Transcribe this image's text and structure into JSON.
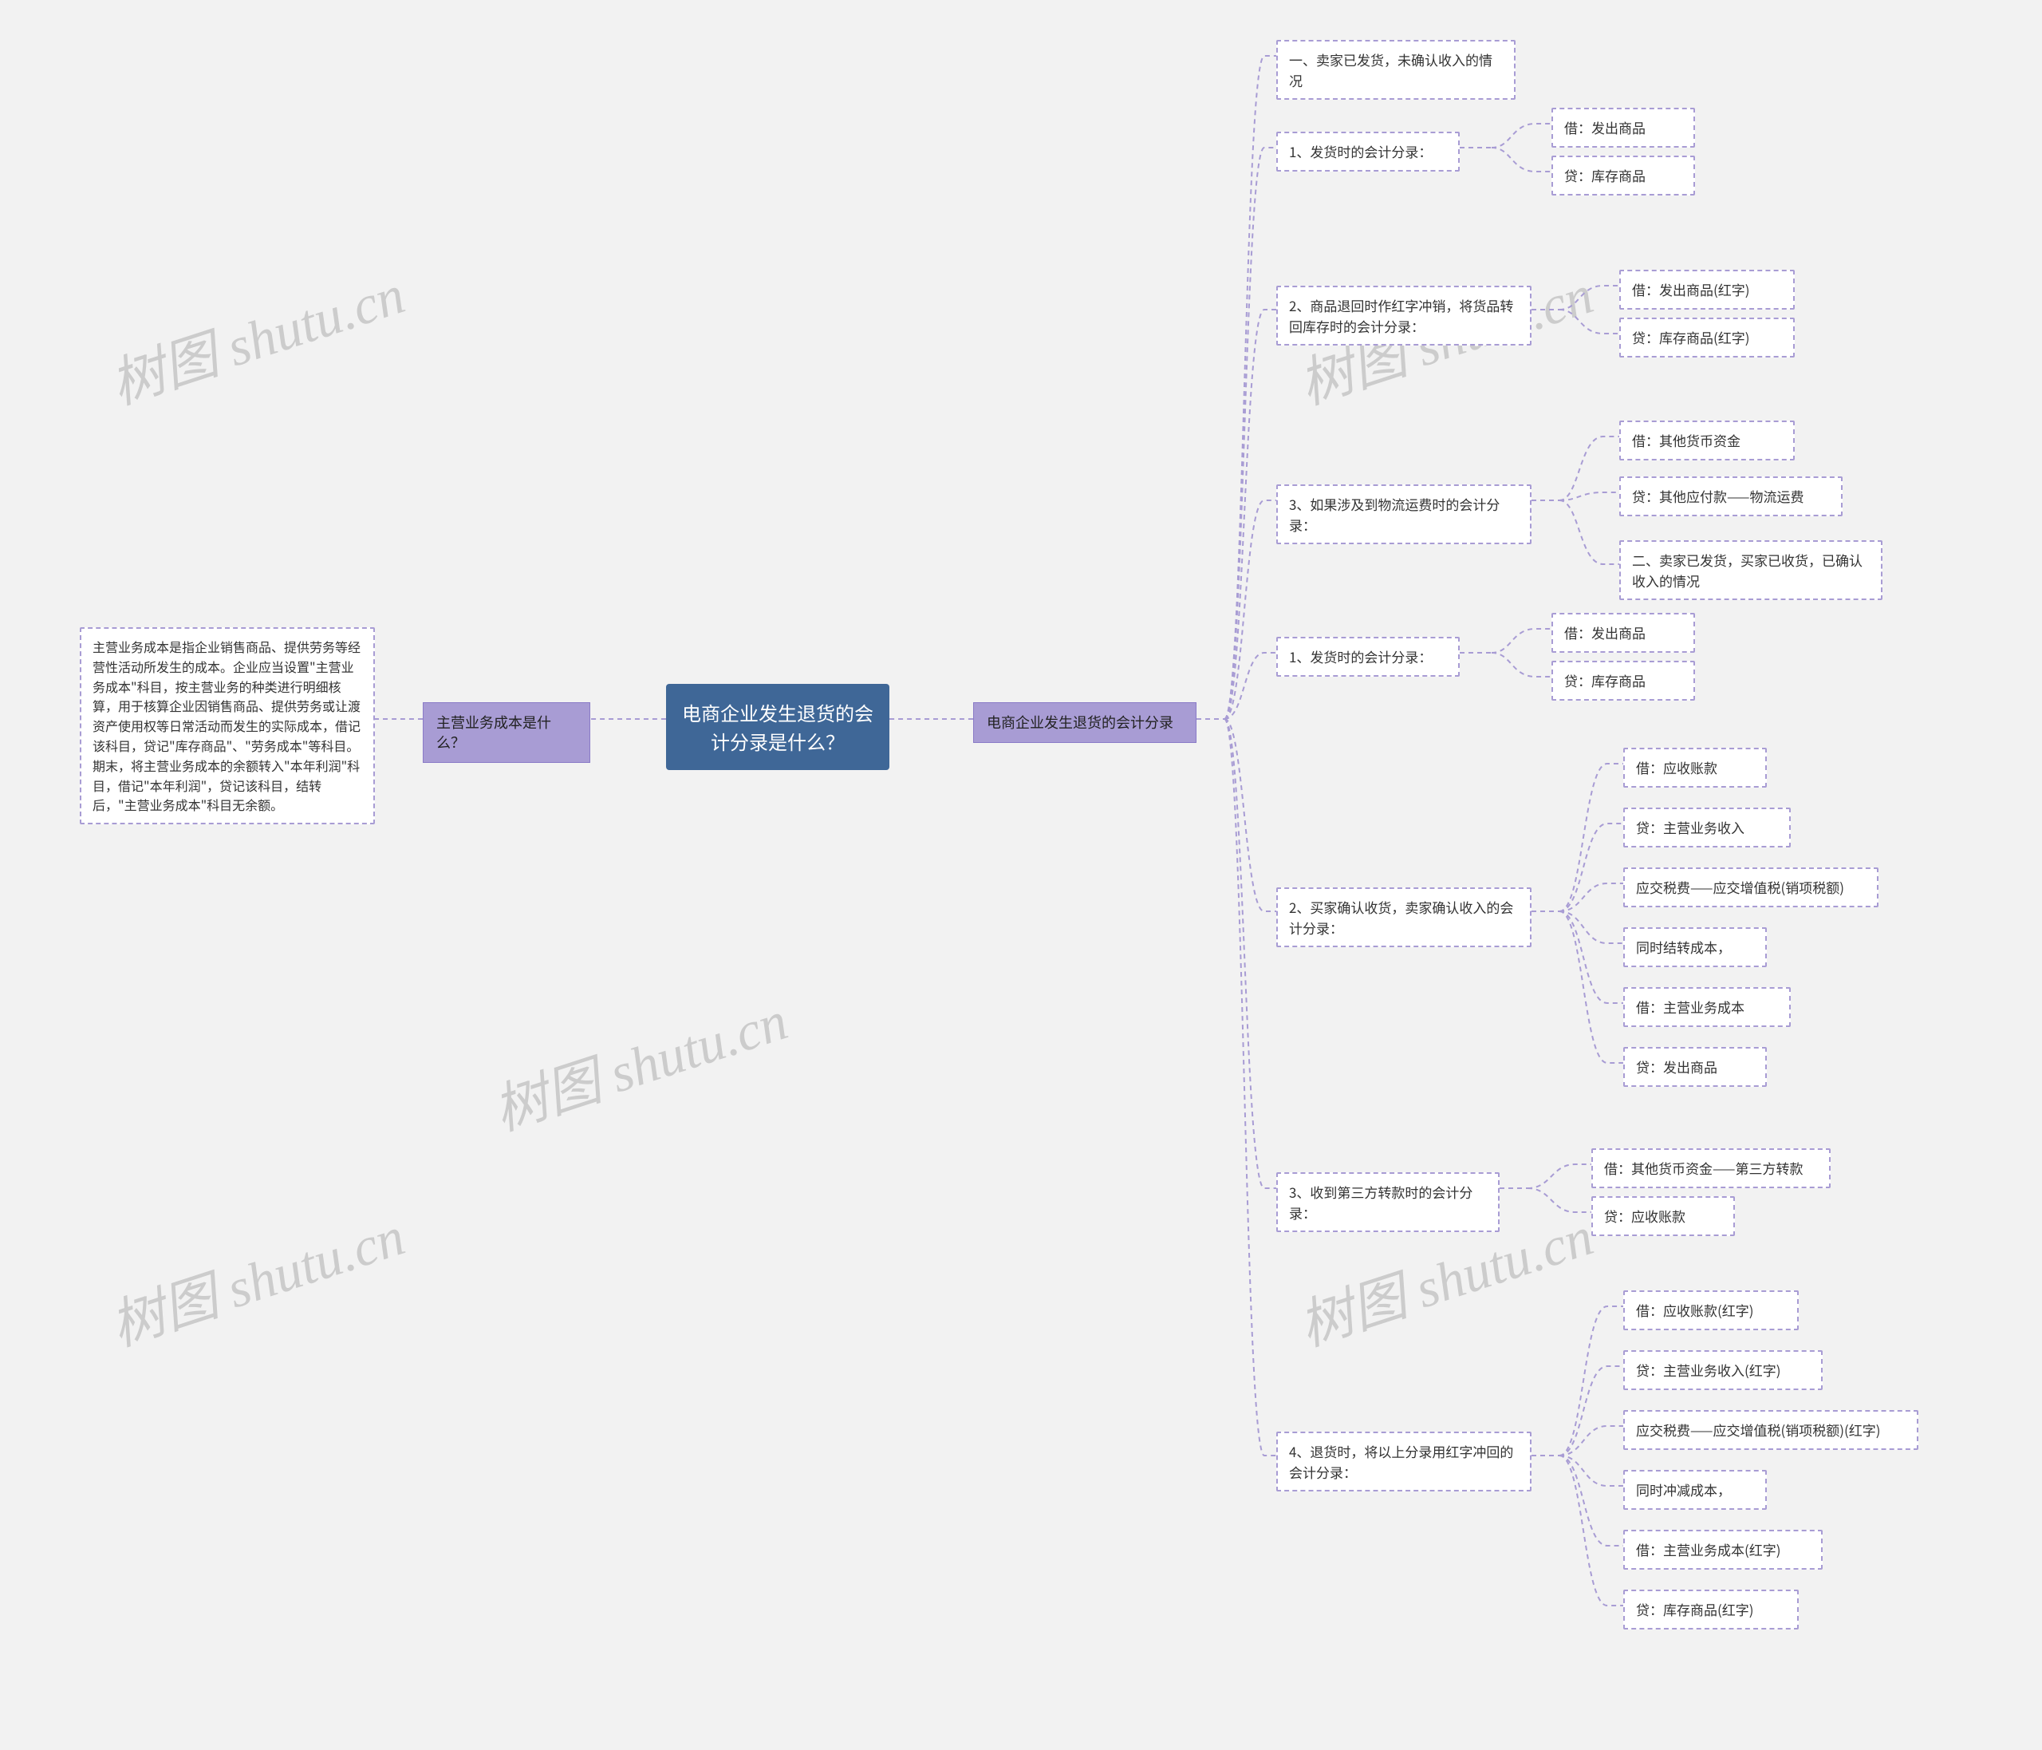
{
  "watermark": "树图 shutu.cn",
  "root": "电商企业发生退货的会计分录是什么？",
  "left_l1": "主营业务成本是什么？",
  "left_leaf": "主营业务成本是指企业销售商品、提供劳务等经营性活动所发生的成本。企业应当设置\"主营业务成本\"科目，按主营业务的种类进行明细核算，用于核算企业因销售商品、提供劳务或让渡资产使用权等日常活动而发生的实际成本，借记该科目，贷记\"库存商品\"、\"劳务成本\"等科目。期末，将主营业务成本的余额转入\"本年利润\"科目，借记\"本年利润\"，贷记该科目，结转后，\"主营业务成本\"科目无余额。",
  "right_l1": "电商企业发生退货的会计分录",
  "r": {
    "n1_title": "一、卖家已发货，未确认收入的情况",
    "n1_1": "1、发货时的会计分录：",
    "n1_1a": "借：发出商品",
    "n1_1b": "贷：库存商品",
    "n1_2": "2、商品退回时作红字冲销，将货品转回库存时的会计分录：",
    "n1_2a": "借：发出商品(红字)",
    "n1_2b": "贷：库存商品(红字)",
    "n1_3": "3、如果涉及到物流运费时的会计分录：",
    "n1_3a": "借：其他货币资金",
    "n1_3b": "贷：其他应付款——物流运费",
    "n2_title": "二、卖家已发货，买家已收货，已确认收入的情况",
    "n2_1": "1、发货时的会计分录：",
    "n2_1a": "借：发出商品",
    "n2_1b": "贷：库存商品",
    "n2_2": "2、买家确认收货，卖家确认收入的会计分录：",
    "n2_2a": "借：应收账款",
    "n2_2b": "贷：主营业务收入",
    "n2_2c": "应交税费——应交增值税(销项税额)",
    "n2_2d": "同时结转成本，",
    "n2_2e": "借：主营业务成本",
    "n2_2f": "贷：发出商品",
    "n2_3": "3、收到第三方转款时的会计分录：",
    "n2_3a": "借：其他货币资金——第三方转款",
    "n2_3b": "贷：应收账款",
    "n2_4": "4、退货时，将以上分录用红字冲回的会计分录：",
    "n2_4a": "借：应收账款(红字)",
    "n2_4b": "贷：主营业务收入(红字)",
    "n2_4c": "应交税费——应交增值税(销项税额)(红字)",
    "n2_4d": "同时冲减成本，",
    "n2_4e": "借：主营业务成本(红字)",
    "n2_4f": "贷：库存商品(红字)"
  }
}
